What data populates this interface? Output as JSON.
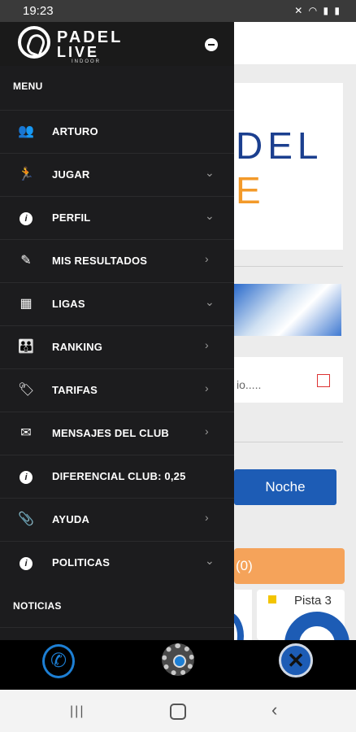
{
  "status_bar": {
    "time": "19:23"
  },
  "brand": {
    "line1": "PADEL",
    "line2": "LIVE",
    "line3": "INDOOR"
  },
  "drawer": {
    "menu_header": "MENU",
    "items": [
      {
        "label": "ARTURO",
        "icon": "users-icon",
        "chevron": ""
      },
      {
        "label": "JUGAR",
        "icon": "running-icon",
        "chevron": "⌄"
      },
      {
        "label": "PERFIL",
        "icon": "info-icon",
        "chevron": "⌄"
      },
      {
        "label": "MIS RESULTADOS",
        "icon": "pencil-icon",
        "chevron": "›"
      },
      {
        "label": "LIGAS",
        "icon": "scoreboard-icon",
        "chevron": "⌄"
      },
      {
        "label": "RANKING",
        "icon": "group-icon",
        "chevron": "›"
      },
      {
        "label": "TARIFAS",
        "icon": "tag-icon",
        "chevron": "›"
      },
      {
        "label": "MENSAJES DEL CLUB",
        "icon": "envelope-icon",
        "chevron": "›"
      },
      {
        "label": "DIFERENCIAL CLUB: 0,25",
        "icon": "info-icon",
        "chevron": ""
      },
      {
        "label": "AYUDA",
        "icon": "paperclip-icon",
        "chevron": "›"
      },
      {
        "label": "POLITICAS",
        "icon": "info-icon",
        "chevron": "⌄"
      }
    ],
    "news_header": "NOTICIAS"
  },
  "background": {
    "logo_top": "DEL",
    "logo_bottom": "E",
    "date_placeholder": "io.....",
    "noche_button": "Noche",
    "orange_bar": "(0)",
    "court_label": "Pista 3"
  },
  "colors": {
    "drawer_bg": "#1c1c1e",
    "accent_blue": "#1d5cb5",
    "accent_orange": "#f5a35a"
  }
}
